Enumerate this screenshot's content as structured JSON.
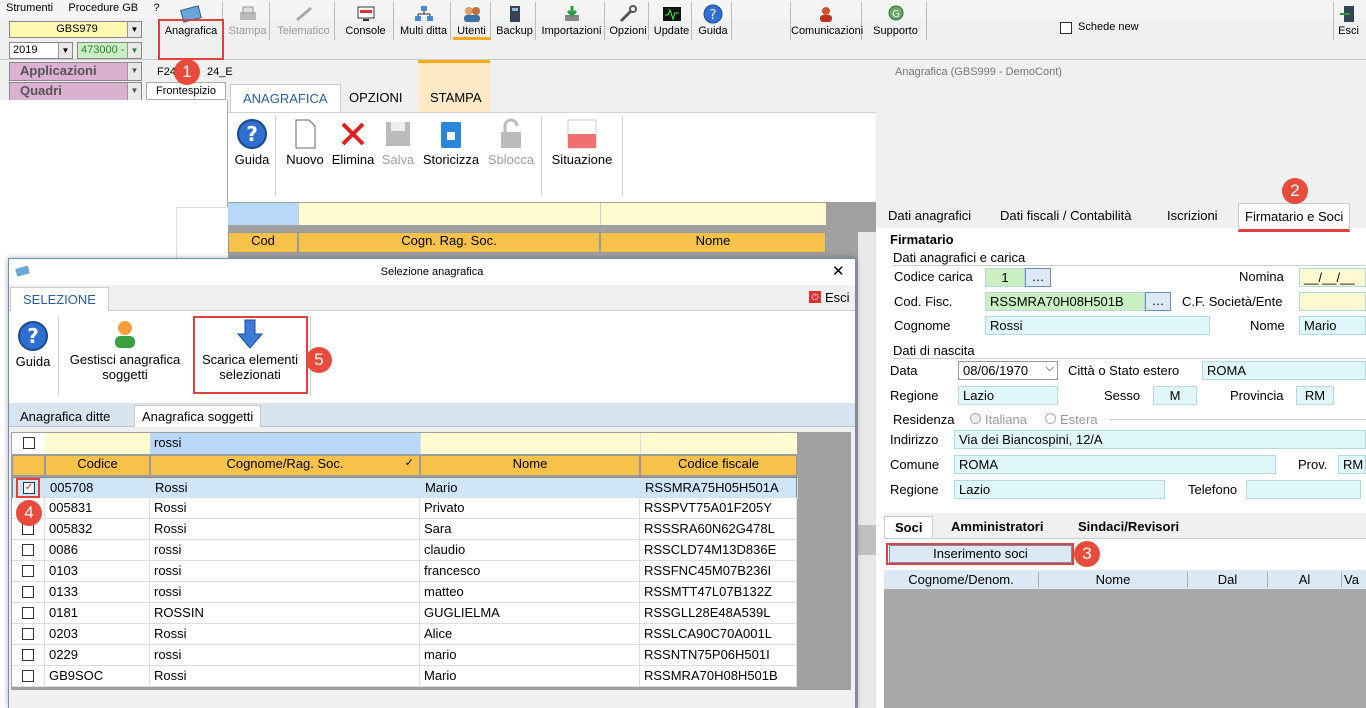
{
  "menu": {
    "items": [
      "Strumenti",
      "Procedure GB",
      "?"
    ]
  },
  "toolbar": {
    "company_code": "GBS979",
    "year": "2019",
    "code_field": "473000 -",
    "applicazioni": "Applicazioni",
    "quadri": "Quadri",
    "f24_label": "F24",
    "f24_extra": "24_E",
    "frontespizio": "Frontespizio",
    "buttons": [
      "Anagrafica",
      "Stampa",
      "Telematico",
      "Console",
      "Multi ditta",
      "Utenti",
      "Backup",
      "Importazioni",
      "Opzioni",
      "Update",
      "Guida",
      "Comunicazioni",
      "Supporto",
      "Esci"
    ],
    "schede_new": "Schede new"
  },
  "window_title": "Anagrafica (GBS999 - DemoCont)",
  "ribbon": {
    "tabs": [
      "ANAGRAFICA",
      "OPZIONI",
      "STAMPA"
    ],
    "buttons": [
      "Guida",
      "Nuovo",
      "Elimina",
      "Salva",
      "Storicizza",
      "Sblocca",
      "Situazione"
    ]
  },
  "main_grid": {
    "headers": [
      "Cod",
      "Cogn. Rag. Soc.",
      "Nome"
    ]
  },
  "right_panel": {
    "tabs": [
      "Dati anagrafici",
      "Dati fiscali / Contabilità",
      "Iscrizioni",
      "Firmatario e Soci"
    ],
    "section_firmatario": "Firmatario",
    "sub_dati": "Dati anagrafici e carica",
    "codice_carica_label": "Codice carica",
    "codice_carica": "1",
    "nomina_label": "Nomina",
    "nomina_value": "__/__/__",
    "cod_fisc_label": "Cod. Fisc.",
    "cod_fisc": "RSSMRA70H08H501B",
    "cf_societa_label": "C.F. Società/Ente",
    "cognome_label": "Cognome",
    "cognome": "Rossi",
    "nome_label": "Nome",
    "nome": "Mario",
    "nascita_label": "Dati di nascita",
    "data_label": "Data",
    "data": "08/06/1970",
    "citta_label": "Città o Stato estero",
    "citta": "ROMA",
    "regione_label": "Regione",
    "regione": "Lazio",
    "sesso_label": "Sesso",
    "sesso": "M",
    "provincia_label": "Provincia",
    "provincia": "RM",
    "residenza_label": "Residenza",
    "italiana": "Italiana",
    "estera": "Estera",
    "indirizzo_label": "Indirizzo",
    "indirizzo": "Via dei Biancospini, 12/A",
    "comune_label": "Comune",
    "comune": "ROMA",
    "prov_label": "Prov.",
    "prov": "RM",
    "regione2_label": "Regione",
    "regione2": "Lazio",
    "telefono_label": "Telefono",
    "soci_tabs": [
      "Soci",
      "Amministratori",
      "Sindaci/Revisori"
    ],
    "inserimento_soci": "Inserimento soci",
    "soci_headers": [
      "Cognome/Denom.",
      "Nome",
      "Dal",
      "Al",
      "Va"
    ]
  },
  "dialog": {
    "title": "Selezione anagrafica",
    "tab": "SELEZIONE",
    "esci": "Esci",
    "buttons": [
      "Guida",
      "Gestisci anagrafica soggetti",
      "Scarica elementi selezionati"
    ],
    "subtabs": [
      "Anagrafica ditte",
      "Anagrafica soggetti"
    ],
    "filter": "rossi",
    "headers": [
      "Codice",
      "Cognome/Rag. Soc.",
      "Nome",
      "Codice fiscale"
    ],
    "rows": [
      {
        "codice": "005708",
        "cognome": "Rossi",
        "nome": "Mario",
        "cf": "RSSMRA75H05H501A"
      },
      {
        "codice": "005831",
        "cognome": "Rossi",
        "nome": "Privato",
        "cf": "RSSPVT75A01F205Y"
      },
      {
        "codice": "005832",
        "cognome": "Rossi",
        "nome": "Sara",
        "cf": "RSSSRA60N62G478L"
      },
      {
        "codice": "0086",
        "cognome": "rossi",
        "nome": "claudio",
        "cf": "RSSCLD74M13D836E"
      },
      {
        "codice": "0103",
        "cognome": "rossi",
        "nome": "francesco",
        "cf": "RSSFNC45M07B236I"
      },
      {
        "codice": "0133",
        "cognome": "rossi",
        "nome": "matteo",
        "cf": "RSSMTT47L07B132Z"
      },
      {
        "codice": "0181",
        "cognome": "ROSSIN",
        "nome": "GUGLIELMA",
        "cf": "RSSGLL28E48A539L"
      },
      {
        "codice": "0203",
        "cognome": "Rossi",
        "nome": "Alice",
        "cf": "RSSLCA90C70A001L"
      },
      {
        "codice": "0229",
        "cognome": "rossi",
        "nome": "mario",
        "cf": "RSSNTN75P06H501I"
      },
      {
        "codice": "GB9SOC",
        "cognome": "Rossi",
        "nome": "Mario",
        "cf": "RSSMRA70H08H501B"
      }
    ]
  },
  "badges": [
    "1",
    "2",
    "3",
    "4",
    "5"
  ]
}
